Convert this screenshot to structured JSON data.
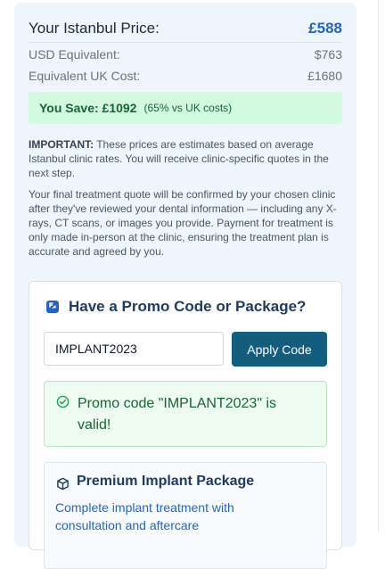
{
  "pricing": {
    "istanbul_label": "Your Istanbul Price:",
    "istanbul_value": "£588",
    "usd_label": "USD Equivalent:",
    "usd_value": "$763",
    "uk_label": "Equivalent UK Cost:",
    "uk_value": "£1680",
    "savings_text": "You Save: £1092",
    "savings_percent": "(65% vs UK costs)"
  },
  "notes": {
    "important_label": "IMPORTANT:",
    "important_text": " These prices are estimates based on average Istanbul clinic rates. You will receive clinic-specific quotes in the next step.",
    "final_quote_text": "Your final treatment quote will be confirmed by your chosen clinic after they've reviewed your dental information — including any X-rays, CT scans, or images you provide. Payment for treatment is only made in-person at the clinic, ensuring the treatment plan is accurate and agreed by you."
  },
  "promo": {
    "title": "Have a Promo Code or Package?",
    "input_value": "IMPLANT2023",
    "apply_label": "Apply Code",
    "success_message": "Promo code \"IMPLANT2023\" is valid!"
  },
  "package": {
    "title": "Premium Implant Package",
    "description": "Complete implant treatment with consultation and aftercare"
  },
  "colors": {
    "accent_blue": "#2563c9",
    "button_teal": "#135e7f",
    "success_green": "#166534",
    "card_background": "#eef5fc"
  },
  "icons": {
    "promo": "ticket-icon",
    "success": "check-circle-icon",
    "package": "package-icon"
  }
}
